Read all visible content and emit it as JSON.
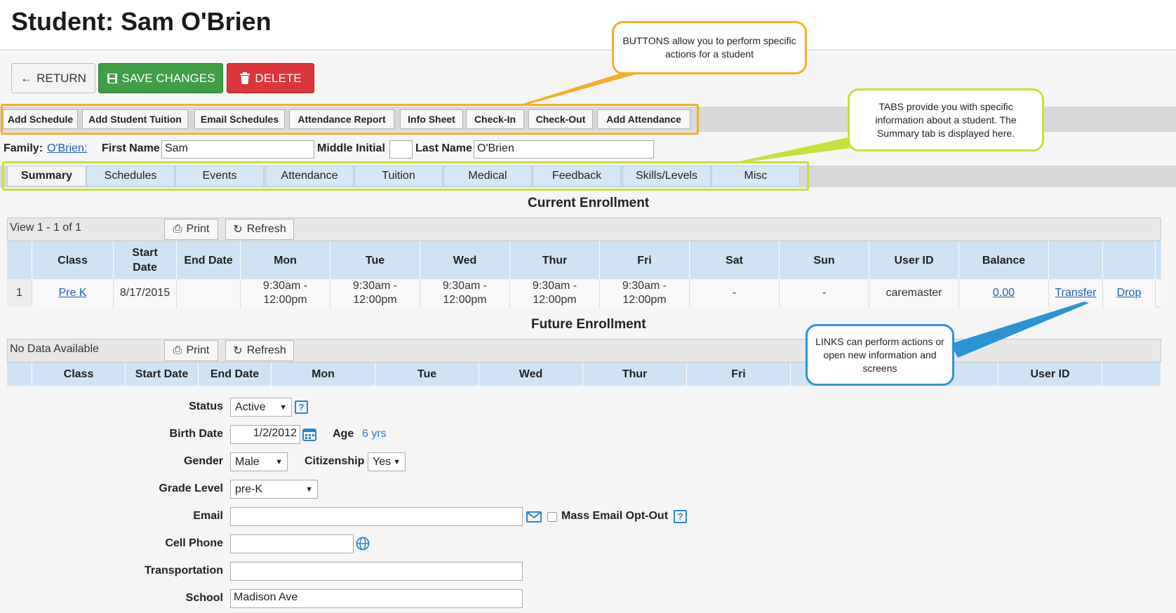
{
  "page": {
    "title": "Student: Sam O'Brien"
  },
  "buttons": {
    "return": "RETURN",
    "save": "SAVE CHANGES",
    "delete": "DELETE"
  },
  "actions": [
    "Add Schedule",
    "Add Student Tuition",
    "Email Schedules",
    "Attendance Report",
    "Info Sheet",
    "Check-In",
    "Check-Out",
    "Add Attendance"
  ],
  "name_row": {
    "family_label": "Family:",
    "family_link": "O'Brien:",
    "first_label": "First Name",
    "first_value": "Sam",
    "middle_label": "Middle Initial",
    "middle_value": "",
    "last_label": "Last Name",
    "last_value": "O'Brien"
  },
  "tabs": [
    "Summary",
    "Schedules",
    "Events",
    "Attendance",
    "Tuition",
    "Medical",
    "Feedback",
    "Skills/Levels",
    "Misc"
  ],
  "current": {
    "title": "Current Enrollment",
    "view": "View 1 - 1 of 1",
    "print": "Print",
    "refresh": "Refresh",
    "headers": [
      "",
      "Class",
      "Start Date",
      "End Date",
      "Mon",
      "Tue",
      "Wed",
      "Thur",
      "Fri",
      "Sat",
      "Sun",
      "User ID",
      "Balance",
      "",
      ""
    ],
    "row": {
      "num": "1",
      "class": "Pre K",
      "start": "8/17/2015",
      "end": "",
      "mon": "9:30am - 12:00pm",
      "tue": "9:30am - 12:00pm",
      "wed": "9:30am - 12:00pm",
      "thur": "9:30am - 12:00pm",
      "fri": "9:30am - 12:00pm",
      "sat": "-",
      "sun": "-",
      "user": "caremaster",
      "balance": "0.00",
      "transfer": "Transfer",
      "drop": "Drop"
    }
  },
  "future": {
    "title": "Future Enrollment",
    "nodata": "No Data Available",
    "print": "Print",
    "refresh": "Refresh",
    "headers": [
      "",
      "Class",
      "Start Date",
      "End Date",
      "Mon",
      "Tue",
      "Wed",
      "Thur",
      "Fri",
      "",
      "",
      "User ID",
      ""
    ]
  },
  "form": {
    "status_label": "Status",
    "status_value": "Active",
    "birth_label": "Birth Date",
    "birth_value": "1/2/2012",
    "age_label": "Age",
    "age_value": "6 yrs",
    "gender_label": "Gender",
    "gender_value": "Male",
    "citizenship_label": "Citizenship",
    "citizenship_value": "Yes",
    "grade_label": "Grade Level",
    "grade_value": "pre-K",
    "email_label": "Email",
    "email_value": "",
    "optout_label": "Mass Email Opt-Out",
    "cell_label": "Cell Phone",
    "cell_value": "",
    "transport_label": "Transportation",
    "transport_value": "",
    "school_label": "School",
    "school_value": "Madison Ave"
  },
  "callouts": {
    "buttons": "BUTTONS allow you to perform specific actions for a student",
    "tabs": "TABS provide you with specific information about a student. The Summary tab is displayed here.",
    "links": "LINKS can perform actions or open new information and screens"
  },
  "colors": {
    "callout_buttons": "#f2b024",
    "callout_tabs": "#c5e13a",
    "callout_links": "#2a94d6",
    "save": "#3e9f45",
    "delete": "#d9373a",
    "link": "#1f5fb5"
  }
}
